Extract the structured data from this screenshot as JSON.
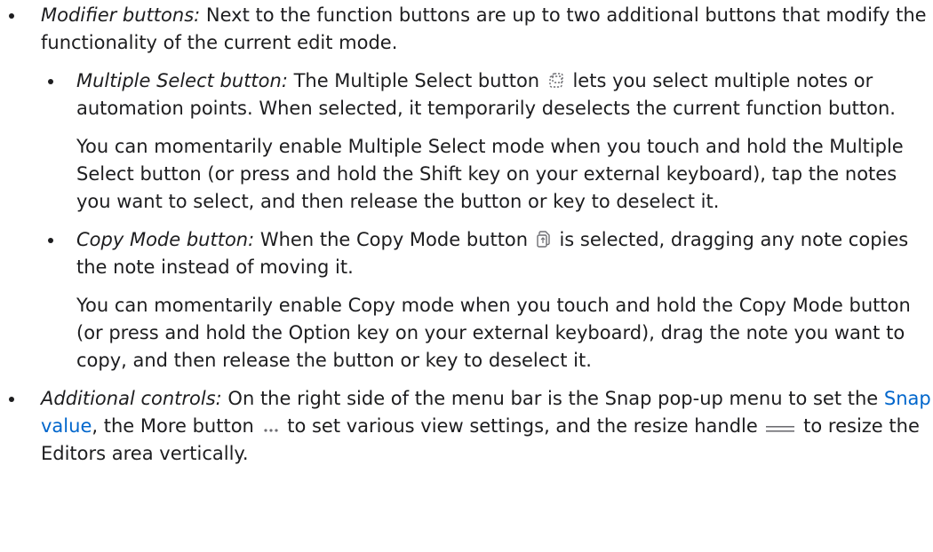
{
  "items": [
    {
      "term": "Modifier buttons:",
      "text": " Next to the function buttons are up to two additional buttons that modify the functionality of the current edit mode.",
      "subitems": [
        {
          "term": "Multiple Select button:",
          "text_before_icon": " The Multiple Select button ",
          "icon": "multiple-select-icon",
          "text_after_icon": " lets you select multiple notes or automation points. When selected, it temporarily deselects the current function button.",
          "paragraph": "You can momentarily enable Multiple Select mode when you touch and hold the Multiple Select button (or press and hold the Shift key on your external keyboard), tap the notes you want to select, and then release the button or key to deselect it."
        },
        {
          "term": "Copy Mode button:",
          "text_before_icon": " When the Copy Mode button ",
          "icon": "copy-mode-icon",
          "text_after_icon": " is selected, dragging any note copies the note instead of moving it.",
          "paragraph": "You can momentarily enable Copy mode when you touch and hold the Copy Mode button (or press and hold the Option key on your external keyboard), drag the note you want to copy, and then release the button or key to deselect it."
        }
      ]
    },
    {
      "term": "Additional controls:",
      "text_1": " On the right side of the menu bar is the Snap pop-up menu to set the ",
      "link": "Snap value",
      "text_2": ", the More button ",
      "icon_more": "more-icon",
      "text_3": " to set various view settings, and the resize handle ",
      "icon_resize": "resize-handle-icon",
      "text_4": " to resize the Editors area vertically."
    }
  ]
}
